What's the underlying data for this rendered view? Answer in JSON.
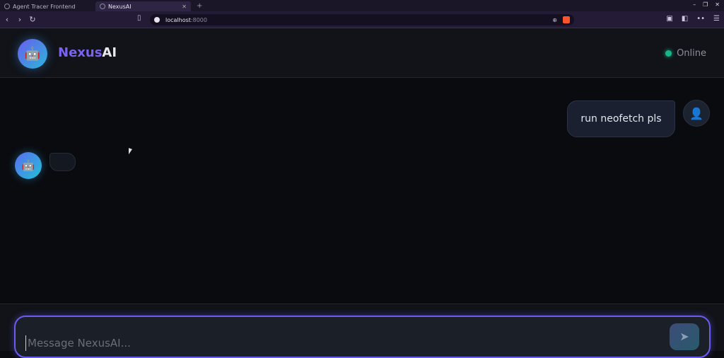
{
  "browser": {
    "tabs": [
      {
        "label": "Agent Tracer Frontend",
        "active": false
      },
      {
        "label": "NexusAI",
        "active": true
      }
    ],
    "new_tab": "+",
    "url_host": "localhost",
    "url_port": ":8000",
    "window_controls": [
      "–",
      "❐",
      "✕"
    ]
  },
  "app": {
    "brand_part1": "Nexus",
    "brand_part2": "AI",
    "status": "Online",
    "status_color": "#17b58a",
    "accent": "#6b5cf0"
  },
  "messages": [
    {
      "role": "user",
      "text": "run neofetch pls"
    },
    {
      "role": "assistant",
      "text": ""
    }
  ],
  "composer": {
    "placeholder": "Message NexusAI...",
    "send_icon": "send-icon"
  }
}
